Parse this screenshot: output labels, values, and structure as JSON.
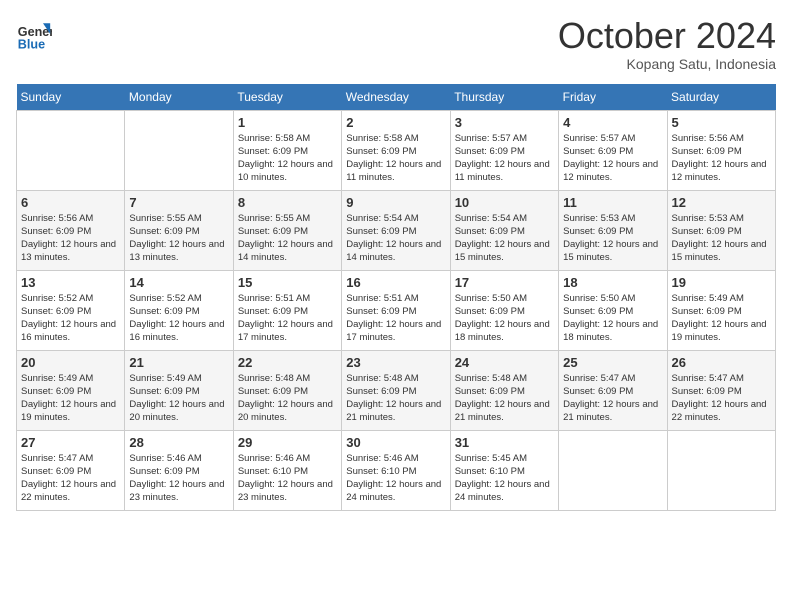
{
  "header": {
    "logo_line1": "General",
    "logo_line2": "Blue",
    "month": "October 2024",
    "location": "Kopang Satu, Indonesia"
  },
  "days_of_week": [
    "Sunday",
    "Monday",
    "Tuesday",
    "Wednesday",
    "Thursday",
    "Friday",
    "Saturday"
  ],
  "weeks": [
    [
      {
        "day": "",
        "info": ""
      },
      {
        "day": "",
        "info": ""
      },
      {
        "day": "1",
        "info": "Sunrise: 5:58 AM\nSunset: 6:09 PM\nDaylight: 12 hours and 10 minutes."
      },
      {
        "day": "2",
        "info": "Sunrise: 5:58 AM\nSunset: 6:09 PM\nDaylight: 12 hours and 11 minutes."
      },
      {
        "day": "3",
        "info": "Sunrise: 5:57 AM\nSunset: 6:09 PM\nDaylight: 12 hours and 11 minutes."
      },
      {
        "day": "4",
        "info": "Sunrise: 5:57 AM\nSunset: 6:09 PM\nDaylight: 12 hours and 12 minutes."
      },
      {
        "day": "5",
        "info": "Sunrise: 5:56 AM\nSunset: 6:09 PM\nDaylight: 12 hours and 12 minutes."
      }
    ],
    [
      {
        "day": "6",
        "info": "Sunrise: 5:56 AM\nSunset: 6:09 PM\nDaylight: 12 hours and 13 minutes."
      },
      {
        "day": "7",
        "info": "Sunrise: 5:55 AM\nSunset: 6:09 PM\nDaylight: 12 hours and 13 minutes."
      },
      {
        "day": "8",
        "info": "Sunrise: 5:55 AM\nSunset: 6:09 PM\nDaylight: 12 hours and 14 minutes."
      },
      {
        "day": "9",
        "info": "Sunrise: 5:54 AM\nSunset: 6:09 PM\nDaylight: 12 hours and 14 minutes."
      },
      {
        "day": "10",
        "info": "Sunrise: 5:54 AM\nSunset: 6:09 PM\nDaylight: 12 hours and 15 minutes."
      },
      {
        "day": "11",
        "info": "Sunrise: 5:53 AM\nSunset: 6:09 PM\nDaylight: 12 hours and 15 minutes."
      },
      {
        "day": "12",
        "info": "Sunrise: 5:53 AM\nSunset: 6:09 PM\nDaylight: 12 hours and 15 minutes."
      }
    ],
    [
      {
        "day": "13",
        "info": "Sunrise: 5:52 AM\nSunset: 6:09 PM\nDaylight: 12 hours and 16 minutes."
      },
      {
        "day": "14",
        "info": "Sunrise: 5:52 AM\nSunset: 6:09 PM\nDaylight: 12 hours and 16 minutes."
      },
      {
        "day": "15",
        "info": "Sunrise: 5:51 AM\nSunset: 6:09 PM\nDaylight: 12 hours and 17 minutes."
      },
      {
        "day": "16",
        "info": "Sunrise: 5:51 AM\nSunset: 6:09 PM\nDaylight: 12 hours and 17 minutes."
      },
      {
        "day": "17",
        "info": "Sunrise: 5:50 AM\nSunset: 6:09 PM\nDaylight: 12 hours and 18 minutes."
      },
      {
        "day": "18",
        "info": "Sunrise: 5:50 AM\nSunset: 6:09 PM\nDaylight: 12 hours and 18 minutes."
      },
      {
        "day": "19",
        "info": "Sunrise: 5:49 AM\nSunset: 6:09 PM\nDaylight: 12 hours and 19 minutes."
      }
    ],
    [
      {
        "day": "20",
        "info": "Sunrise: 5:49 AM\nSunset: 6:09 PM\nDaylight: 12 hours and 19 minutes."
      },
      {
        "day": "21",
        "info": "Sunrise: 5:49 AM\nSunset: 6:09 PM\nDaylight: 12 hours and 20 minutes."
      },
      {
        "day": "22",
        "info": "Sunrise: 5:48 AM\nSunset: 6:09 PM\nDaylight: 12 hours and 20 minutes."
      },
      {
        "day": "23",
        "info": "Sunrise: 5:48 AM\nSunset: 6:09 PM\nDaylight: 12 hours and 21 minutes."
      },
      {
        "day": "24",
        "info": "Sunrise: 5:48 AM\nSunset: 6:09 PM\nDaylight: 12 hours and 21 minutes."
      },
      {
        "day": "25",
        "info": "Sunrise: 5:47 AM\nSunset: 6:09 PM\nDaylight: 12 hours and 21 minutes."
      },
      {
        "day": "26",
        "info": "Sunrise: 5:47 AM\nSunset: 6:09 PM\nDaylight: 12 hours and 22 minutes."
      }
    ],
    [
      {
        "day": "27",
        "info": "Sunrise: 5:47 AM\nSunset: 6:09 PM\nDaylight: 12 hours and 22 minutes."
      },
      {
        "day": "28",
        "info": "Sunrise: 5:46 AM\nSunset: 6:09 PM\nDaylight: 12 hours and 23 minutes."
      },
      {
        "day": "29",
        "info": "Sunrise: 5:46 AM\nSunset: 6:10 PM\nDaylight: 12 hours and 23 minutes."
      },
      {
        "day": "30",
        "info": "Sunrise: 5:46 AM\nSunset: 6:10 PM\nDaylight: 12 hours and 24 minutes."
      },
      {
        "day": "31",
        "info": "Sunrise: 5:45 AM\nSunset: 6:10 PM\nDaylight: 12 hours and 24 minutes."
      },
      {
        "day": "",
        "info": ""
      },
      {
        "day": "",
        "info": ""
      }
    ]
  ]
}
